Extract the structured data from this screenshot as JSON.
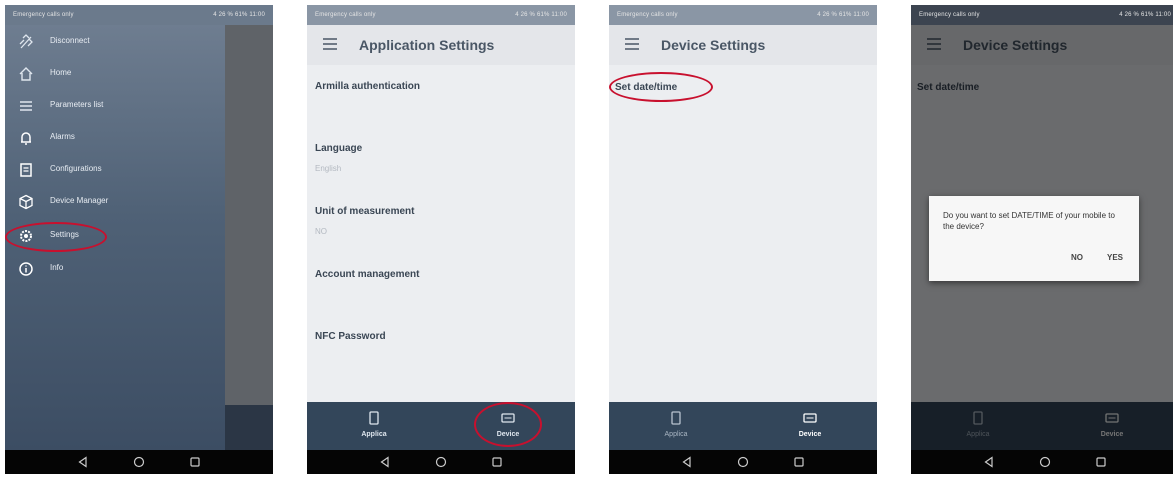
{
  "status_bar": {
    "left": "Emergency calls only",
    "right": "4 26 % 61% 11:00"
  },
  "drawer": {
    "items": [
      {
        "label": "Disconnect",
        "icon": "link-off-icon"
      },
      {
        "label": "Home",
        "icon": "home-icon"
      },
      {
        "label": "Parameters list",
        "icon": "list-icon"
      },
      {
        "label": "Alarms",
        "icon": "bell-icon"
      },
      {
        "label": "Configurations",
        "icon": "clipboard-icon"
      },
      {
        "label": "Device Manager",
        "icon": "cube-icon"
      },
      {
        "label": "Settings",
        "icon": "gear-icon"
      },
      {
        "label": "Info",
        "icon": "info-icon"
      }
    ]
  },
  "app_settings": {
    "title": "Application Settings",
    "items": [
      {
        "title": "Armilla authentication",
        "value": ""
      },
      {
        "title": "Language",
        "value": "English"
      },
      {
        "title": "Unit of measurement",
        "value": "NO"
      },
      {
        "title": "Account management",
        "value": ""
      },
      {
        "title": "NFC Password",
        "value": ""
      }
    ]
  },
  "device_settings": {
    "title": "Device Settings",
    "items": [
      {
        "title": "Set date/time"
      }
    ]
  },
  "bottom_tabs": [
    {
      "label": "Applica",
      "icon": "phone-icon"
    },
    {
      "label": "Device",
      "icon": "device-icon"
    }
  ],
  "dialog": {
    "message": "Do you want to set DATE/TIME of your mobile to the device?",
    "no_label": "NO",
    "yes_label": "YES"
  },
  "colors": {
    "accent_ring": "#c8102e",
    "bottom_bar": "#33465a",
    "drawer": "#4f6176"
  }
}
